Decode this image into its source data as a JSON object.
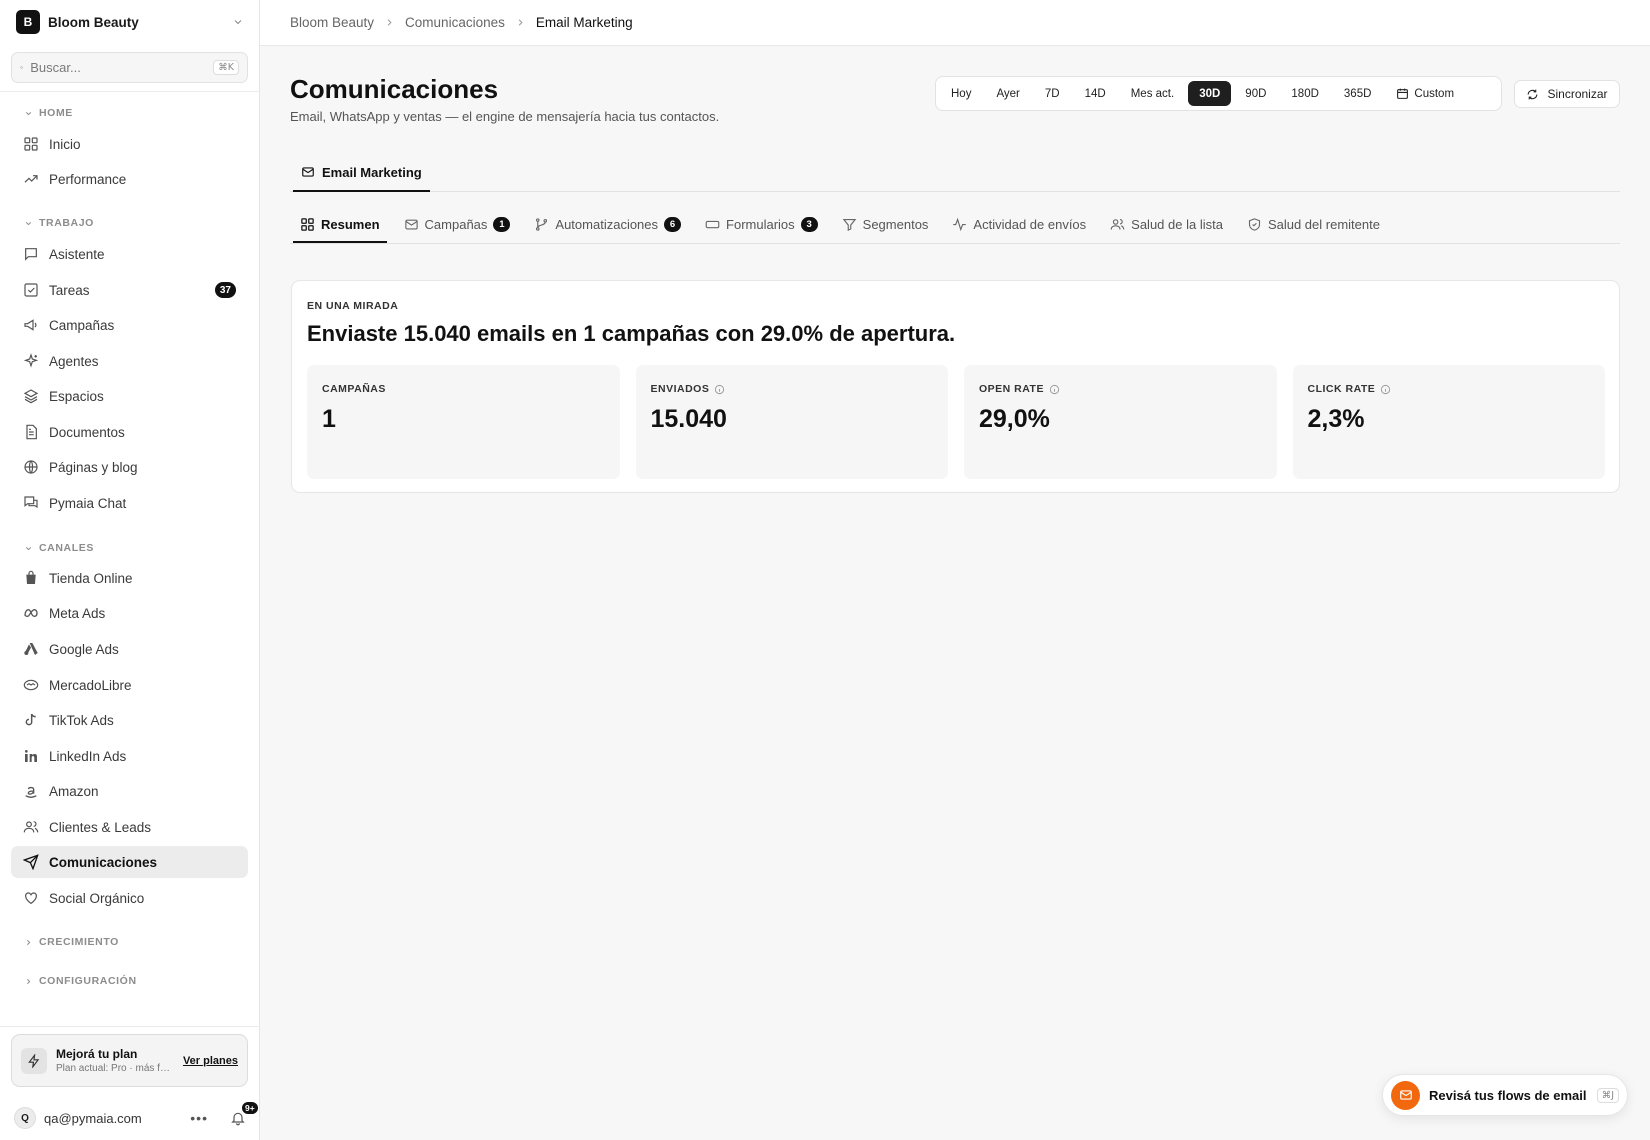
{
  "workspace": {
    "initial": "B",
    "name": "Bloom Beauty"
  },
  "search": {
    "placeholder": "Buscar...",
    "shortcut": "⌘K"
  },
  "sidebar": {
    "sections": {
      "home": "HOME",
      "trabajo": "TRABAJO",
      "canales": "CANALES",
      "crecimiento": "CRECIMIENTO",
      "configuracion": "CONFIGURACIÓN"
    },
    "home_items": [
      {
        "label": "Inicio",
        "icon": "grid-icon"
      },
      {
        "label": "Performance",
        "icon": "trending-up-icon"
      }
    ],
    "trabajo_items": [
      {
        "label": "Asistente",
        "icon": "message-square-icon"
      },
      {
        "label": "Tareas",
        "icon": "checkbox-icon",
        "badge": "37"
      },
      {
        "label": "Campañas",
        "icon": "megaphone-icon"
      },
      {
        "label": "Agentes",
        "icon": "sparkles-icon"
      },
      {
        "label": "Espacios",
        "icon": "layers-icon"
      },
      {
        "label": "Documentos",
        "icon": "file-text-icon"
      },
      {
        "label": "Páginas y blog",
        "icon": "globe-icon"
      },
      {
        "label": "Pymaia Chat",
        "icon": "messages-icon"
      }
    ],
    "canales_items": [
      {
        "label": "Tienda Online",
        "icon": "shopping-bag-icon"
      },
      {
        "label": "Meta Ads",
        "icon": "meta-icon"
      },
      {
        "label": "Google Ads",
        "icon": "google-ads-icon"
      },
      {
        "label": "MercadoLibre",
        "icon": "handshake-icon"
      },
      {
        "label": "TikTok Ads",
        "icon": "tiktok-icon"
      },
      {
        "label": "LinkedIn Ads",
        "icon": "linkedin-icon"
      },
      {
        "label": "Amazon",
        "icon": "amazon-icon"
      },
      {
        "label": "Clientes & Leads",
        "icon": "users-icon"
      },
      {
        "label": "Comunicaciones",
        "icon": "send-icon",
        "active": true
      },
      {
        "label": "Social Orgánico",
        "icon": "heart-icon"
      }
    ],
    "plan": {
      "title": "Mejorá tu plan",
      "subtitle": "Plan actual: Pro · más funcionalidades",
      "link": "Ver planes"
    },
    "user": {
      "initial": "Q",
      "email": "qa@pymaia.com",
      "notifications": "9+"
    }
  },
  "breadcrumb": [
    "Bloom Beauty",
    "Comunicaciones",
    "Email Marketing"
  ],
  "page": {
    "title": "Comunicaciones",
    "subtitle": "Email, WhatsApp y ventas — el engine de mensajería hacia tus contactos."
  },
  "date_range": {
    "options": [
      "Hoy",
      "Ayer",
      "7D",
      "14D",
      "Mes act.",
      "30D",
      "90D",
      "180D",
      "365D"
    ],
    "selected": "30D",
    "custom_label": "Custom"
  },
  "sync_label": "Sincronizar",
  "primary_tab": "Email Marketing",
  "sub_tabs": [
    {
      "label": "Resumen",
      "icon": "grid-icon",
      "active": true
    },
    {
      "label": "Campañas",
      "icon": "mail-icon",
      "count": "1"
    },
    {
      "label": "Automatizaciones",
      "icon": "git-branch-icon",
      "count": "6"
    },
    {
      "label": "Formularios",
      "icon": "form-input-icon",
      "count": "3"
    },
    {
      "label": "Segmentos",
      "icon": "filter-icon"
    },
    {
      "label": "Actividad de envíos",
      "icon": "activity-icon"
    },
    {
      "label": "Salud de la lista",
      "icon": "users-icon"
    },
    {
      "label": "Salud del remitente",
      "icon": "shield-icon"
    }
  ],
  "summary": {
    "eyebrow": "EN UNA MIRADA",
    "headline": "Enviaste 15.040 emails en 1 campañas con 29.0% de apertura.",
    "kpis": [
      {
        "label": "CAMPAÑAS",
        "value": "1",
        "info": false
      },
      {
        "label": "ENVIADOS",
        "value": "15.040",
        "info": true
      },
      {
        "label": "OPEN RATE",
        "value": "29,0%",
        "info": true
      },
      {
        "label": "CLICK RATE",
        "value": "2,3%",
        "info": true
      }
    ]
  },
  "toast": {
    "label": "Revisá tus flows de email",
    "shortcut": "⌘J"
  },
  "colors": {
    "accent_dark": "#111111",
    "toast_orange": "#f2680f",
    "active_nav_bg": "#ececec"
  }
}
